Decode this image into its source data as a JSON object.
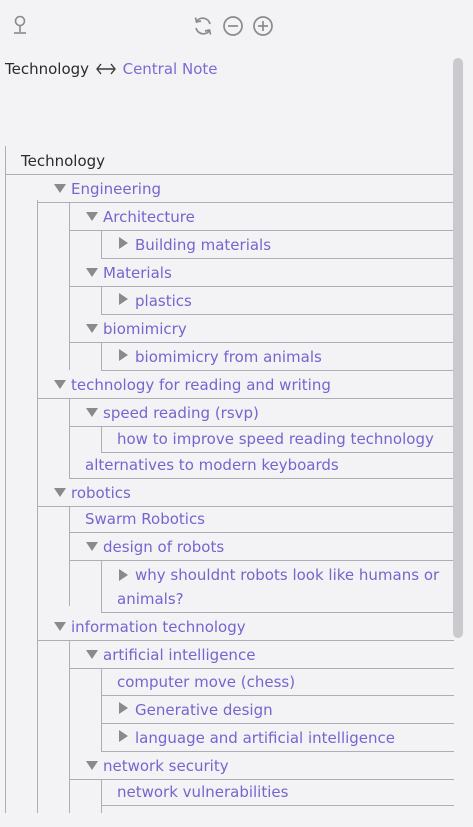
{
  "toolbar": {
    "icons": [
      "pin-icon",
      "refresh-icon",
      "collapse-icon",
      "expand-icon"
    ]
  },
  "header": {
    "note": "Technology",
    "central_note": "Central Note"
  },
  "tree": {
    "root": "Technology",
    "items": [
      "Engineering",
      "Architecture",
      "Building materials",
      "Materials",
      "plastics",
      "biomimicry",
      "biomimicry from animals",
      "technology for reading and writing",
      "speed reading (rsvp)",
      "how to improve speed reading technology",
      "alternatives to modern keyboards",
      "robotics",
      "Swarm Robotics",
      "design of robots",
      "why shouldnt robots look like humans or",
      "animals?",
      "information technology",
      "artificial intelligence",
      "computer move (chess)",
      "Generative design",
      "language and artificial intelligence",
      "network security",
      "network vulnerabilities"
    ]
  },
  "colors": {
    "link": "#7466cf",
    "text": "#2b2b2b",
    "line": "#aeaeb4",
    "background": "#f3f3f5"
  }
}
